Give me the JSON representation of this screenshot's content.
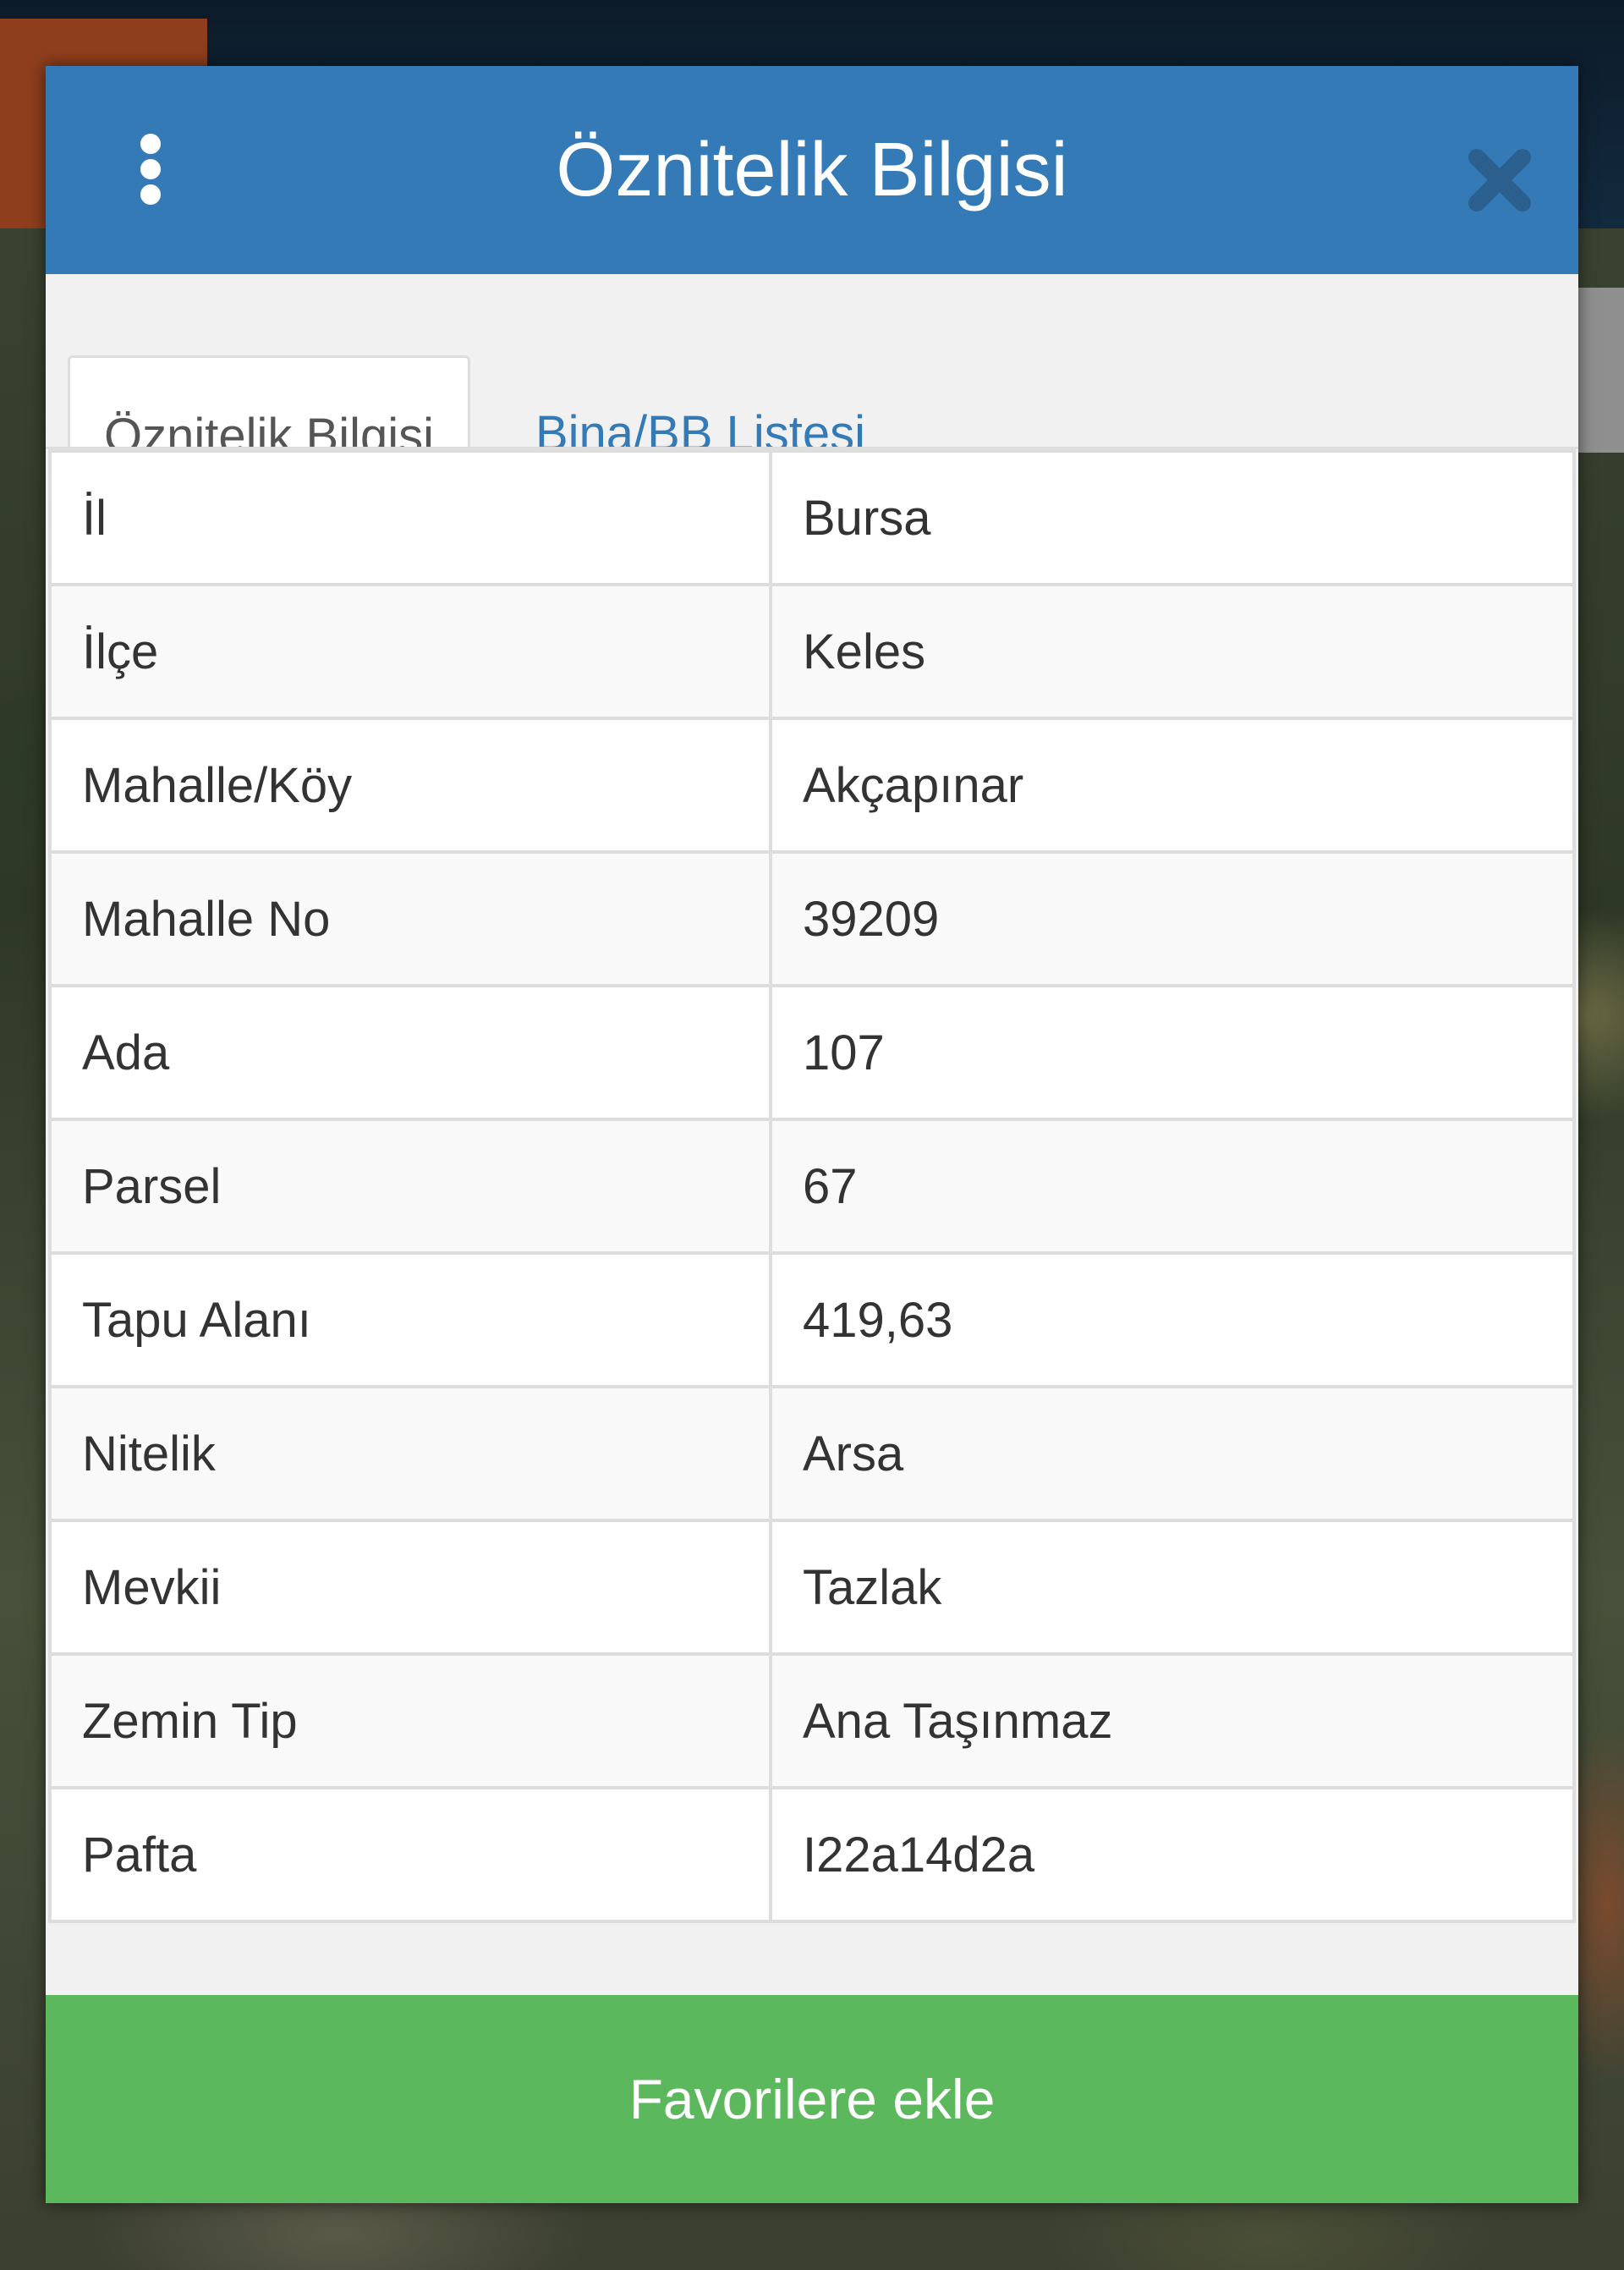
{
  "header": {
    "title": "Öznitelik Bilgisi"
  },
  "tabs": [
    {
      "label": "Öznitelik Bilgisi",
      "active": true
    },
    {
      "label": "Bina/BB Listesi",
      "active": false
    }
  ],
  "attributes": [
    {
      "key": "İl",
      "value": "Bursa"
    },
    {
      "key": "İlçe",
      "value": "Keles"
    },
    {
      "key": "Mahalle/Köy",
      "value": "Akçapınar"
    },
    {
      "key": "Mahalle No",
      "value": "39209"
    },
    {
      "key": "Ada",
      "value": "107"
    },
    {
      "key": "Parsel",
      "value": "67"
    },
    {
      "key": "Tapu Alanı",
      "value": "419,63"
    },
    {
      "key": "Nitelik",
      "value": "Arsa"
    },
    {
      "key": "Mevkii",
      "value": "Tazlak"
    },
    {
      "key": "Zemin Tip",
      "value": "Ana Taşınmaz"
    },
    {
      "key": "Pafta",
      "value": "I22a14d2a"
    }
  ],
  "footer": {
    "favorite_label": "Favorilere ekle"
  },
  "colors": {
    "header": "#337ab7",
    "link": "#337ab7",
    "favorite_button": "#5cb85c",
    "close_icon": "#2a5f8e"
  },
  "icons": {
    "menu": "more-vertical-icon",
    "close": "close-icon"
  }
}
